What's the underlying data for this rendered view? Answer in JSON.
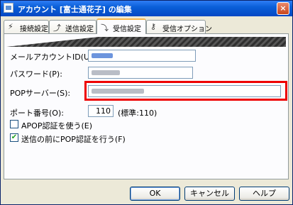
{
  "window": {
    "title": "アカウント [富士通花子] の編集",
    "close_label": "×"
  },
  "tabs": [
    {
      "label": "接続設定",
      "icon": "plug-icon"
    },
    {
      "label": "送信設定",
      "icon": "send-icon"
    },
    {
      "label": "受信設定",
      "icon": "receive-icon",
      "active": true
    },
    {
      "label": "受信オプション",
      "icon": "key-icon"
    }
  ],
  "form": {
    "mail_account_id_label": "メールアカウントID(U):",
    "password_label": "パスワード(P):",
    "pop_server_label": "POPサーバー(S):",
    "port_label": "ポート番号(O):",
    "port_value": "110",
    "port_default": "(標準:110)",
    "apop_label": "APOP認証を使う(E)",
    "apop_checked": false,
    "pop_before_send_label": "送信の前にPOP認証を行う(F)",
    "pop_before_send_checked": true,
    "check_glyph": "✔"
  },
  "buttons": {
    "ok": "OK",
    "cancel": "キャンセル",
    "help": "ヘルプ"
  },
  "colors": {
    "highlight": "#e00000",
    "title_bar": "#0a5fd8"
  }
}
